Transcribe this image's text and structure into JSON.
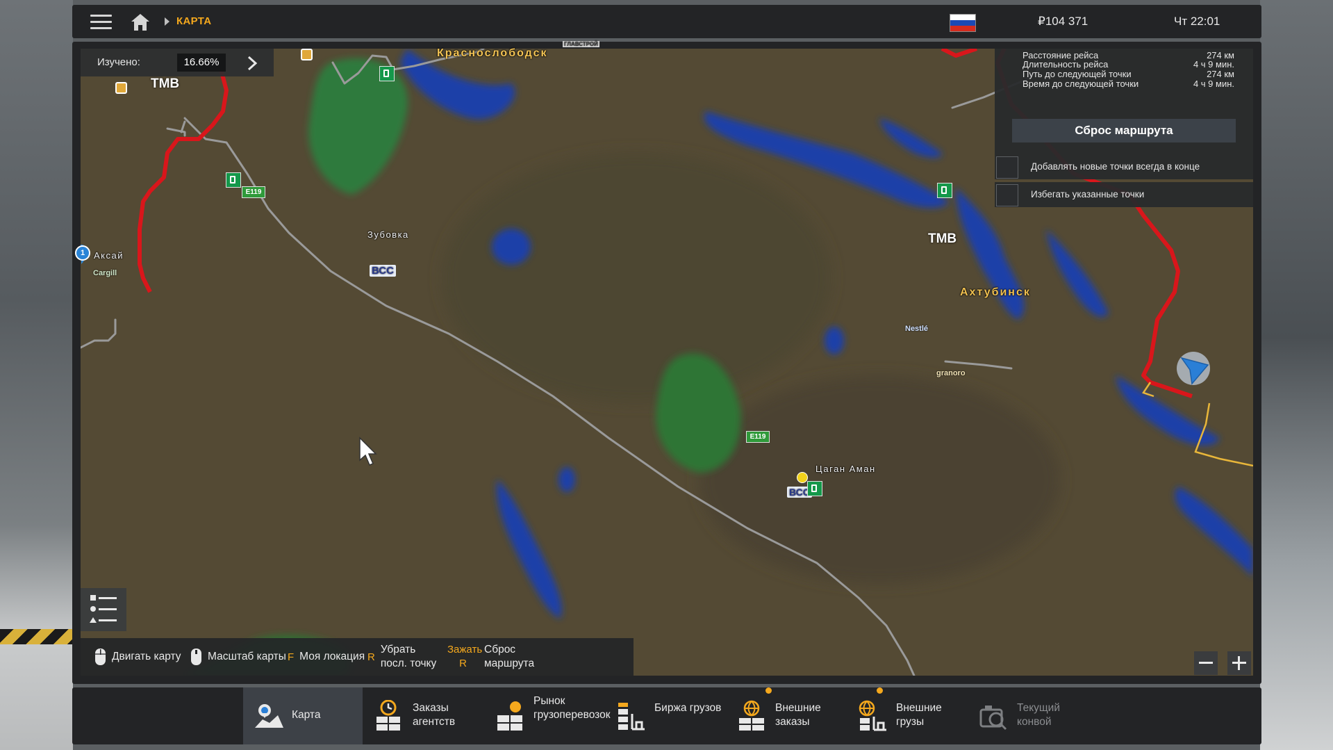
{
  "topbar": {
    "breadcrumb": "КАРТА",
    "money": "₽104 371",
    "clock": "Чт 22:01",
    "icons": [
      "menu-icon",
      "home-icon",
      "russia-flag-icon"
    ]
  },
  "explored": {
    "label": "Изучено:",
    "value": "16.66%"
  },
  "route": {
    "rows": [
      {
        "key": "Расстояние рейса",
        "value": "274 км"
      },
      {
        "key": "Длительность рейса",
        "value": "4 ч 9 мин."
      },
      {
        "key": "Путь до следующей точки",
        "value": "274 км"
      },
      {
        "key": "Время до следующей точки",
        "value": "4 ч 9 мин."
      }
    ],
    "reset_label": "Сброс маршрута",
    "options": [
      {
        "label": "Добавлять новые точки всегда в конце",
        "checked": false
      },
      {
        "label": "Избегать указанные точки",
        "checked": false
      }
    ]
  },
  "map": {
    "cities": {
      "krasnoslobodsk": "Краснослободск",
      "akhtubinsk": "Ахтубинск",
      "aksai": "Аксай",
      "zubovka": "Зубовка",
      "tsagan_aman": "Цаган Аман"
    },
    "brands": {
      "tmb": "TMB",
      "vss": "ВСС",
      "cargill": "Cargill",
      "nestle": "Nestlé",
      "granoro": "granoro",
      "glavstroy": "ГЛАВСТРОЙ"
    },
    "road": "E119",
    "marker_number": "1",
    "colors": {
      "route": "#d9161b",
      "road": "#9a9a9a",
      "water": "#1e3fa8",
      "forest": "#2f7a3c",
      "accent": "#f4a81d"
    }
  },
  "hints": [
    {
      "key": "",
      "label": "Двигать карту",
      "icon": "mouse-icon"
    },
    {
      "key": "",
      "label": "Масштаб карты",
      "icon": "mouse-scroll-icon"
    },
    {
      "key": "F",
      "label": "Моя локация"
    },
    {
      "key": "R",
      "label": "Убрать посл. точку"
    },
    {
      "key": "Зажать R",
      "label": "Сброс маршрута"
    }
  ],
  "nav": [
    {
      "label": "Карта",
      "icon": "map-icon",
      "active": true
    },
    {
      "label": "Заказы агентств",
      "icon": "agency-orders-icon"
    },
    {
      "label": "Рынок грузоперевозок",
      "icon": "freight-market-icon"
    },
    {
      "label": "Биржа грузов",
      "icon": "cargo-exchange-icon"
    },
    {
      "label": "Внешние заказы",
      "icon": "external-orders-icon",
      "notification": true
    },
    {
      "label": "Внешние грузы",
      "icon": "external-cargo-icon",
      "notification": true
    },
    {
      "label": "Текущий конвой",
      "icon": "convoy-icon",
      "disabled": true
    }
  ]
}
